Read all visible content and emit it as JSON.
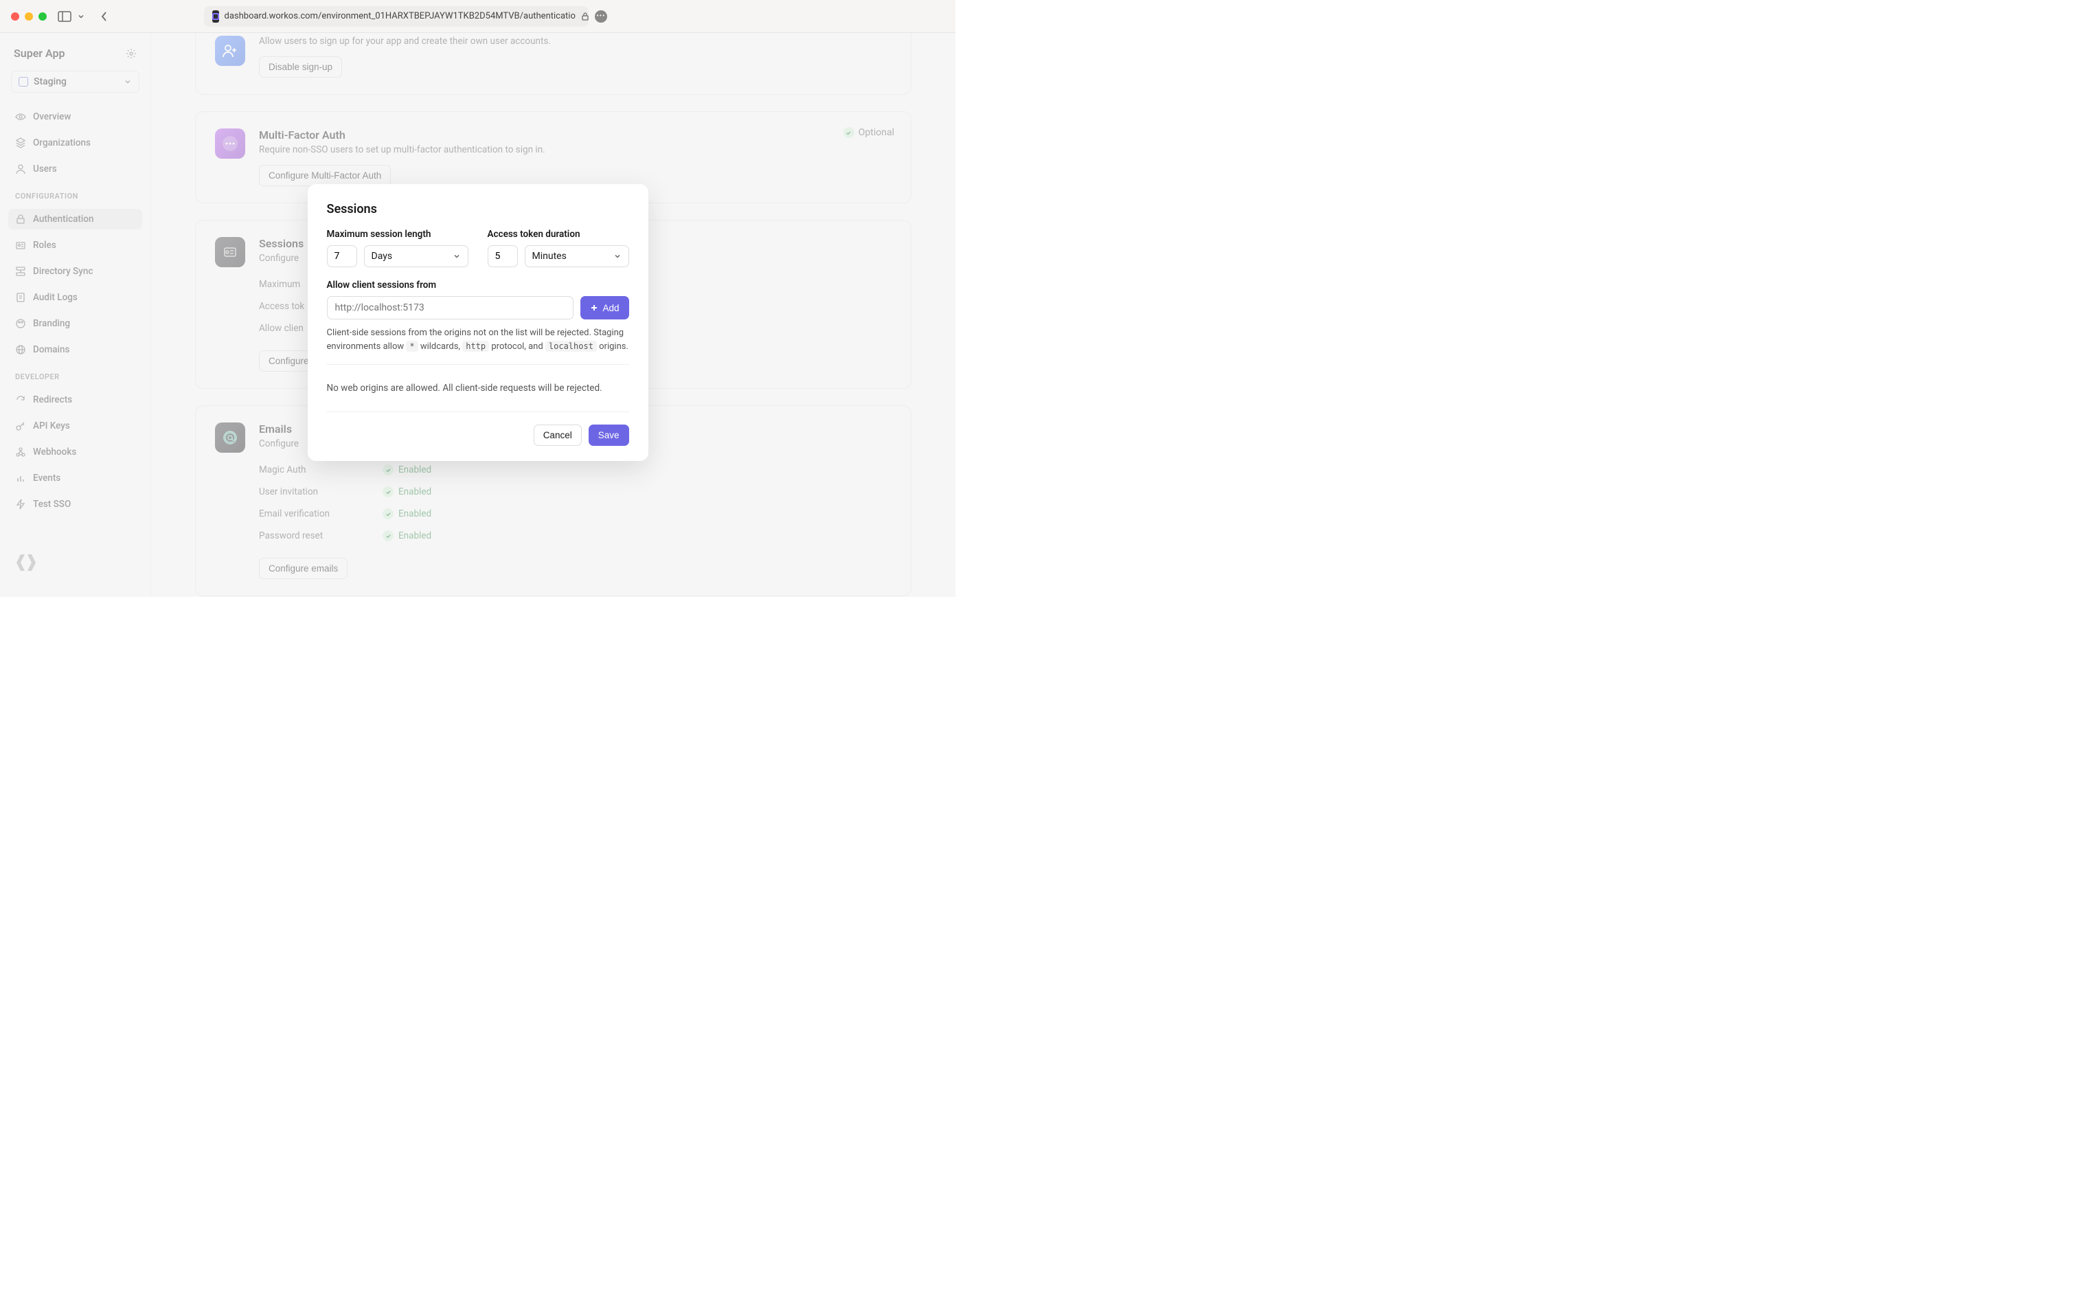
{
  "browser": {
    "url": "dashboard.workos.com/environment_01HARXTBEPJAYW1TKB2D54MTVB/authenticatio"
  },
  "sidebar": {
    "app_name": "Super App",
    "environment": "Staging",
    "nav_top": [
      {
        "label": "Overview",
        "icon": "eye"
      },
      {
        "label": "Organizations",
        "icon": "layers"
      },
      {
        "label": "Users",
        "icon": "user"
      }
    ],
    "section_config_label": "CONFIGURATION",
    "nav_config": [
      {
        "label": "Authentication",
        "icon": "lock",
        "active": true
      },
      {
        "label": "Roles",
        "icon": "id"
      },
      {
        "label": "Directory Sync",
        "icon": "sync"
      },
      {
        "label": "Audit Logs",
        "icon": "clipboard"
      },
      {
        "label": "Branding",
        "icon": "palette"
      },
      {
        "label": "Domains",
        "icon": "globe"
      }
    ],
    "section_dev_label": "DEVELOPER",
    "nav_dev": [
      {
        "label": "Redirects",
        "icon": "redo"
      },
      {
        "label": "API Keys",
        "icon": "key"
      },
      {
        "label": "Webhooks",
        "icon": "hook"
      },
      {
        "label": "Events",
        "icon": "bars"
      },
      {
        "label": "Test SSO",
        "icon": "bolt"
      }
    ]
  },
  "cards": {
    "signup": {
      "desc": "Allow users to sign up for your app and create their own user accounts.",
      "button": "Disable sign-up"
    },
    "mfa": {
      "title": "Multi-Factor Auth",
      "desc": "Require non-SSO users to set up multi-factor authentication to sign in.",
      "button": "Configure Multi-Factor Auth",
      "tag": "Optional"
    },
    "sessions": {
      "title": "Sessions",
      "desc": "Configure",
      "rows": [
        {
          "key": "Maximum",
          "val": ""
        },
        {
          "key": "Access tok",
          "val": ""
        },
        {
          "key": "Allow clien",
          "val": ""
        }
      ],
      "button": "Configure"
    },
    "emails": {
      "title": "Emails",
      "desc": "Configure",
      "rows": [
        {
          "key": "Magic Auth",
          "val": "Enabled"
        },
        {
          "key": "User invitation",
          "val": "Enabled"
        },
        {
          "key": "Email verification",
          "val": "Enabled"
        },
        {
          "key": "Password reset",
          "val": "Enabled"
        }
      ],
      "button": "Configure emails"
    }
  },
  "modal": {
    "title": "Sessions",
    "max_session_label": "Maximum session length",
    "max_session_value": "7",
    "max_session_unit": "Days",
    "access_token_label": "Access token duration",
    "access_token_value": "5",
    "access_token_unit": "Minutes",
    "origins_label": "Allow client sessions from",
    "origins_placeholder": "http://localhost:5173",
    "add_button": "Add",
    "helper_prefix": "Client-side sessions from the origins not on the list will be rejected. Staging environments allow ",
    "helper_code1": "*",
    "helper_mid1": " wildcards, ",
    "helper_code2": "http",
    "helper_mid2": " protocol, and ",
    "helper_code3": "localhost",
    "helper_suffix": " origins.",
    "empty_origins": "No web origins are allowed. All client-side requests will be rejected.",
    "cancel": "Cancel",
    "save": "Save"
  }
}
